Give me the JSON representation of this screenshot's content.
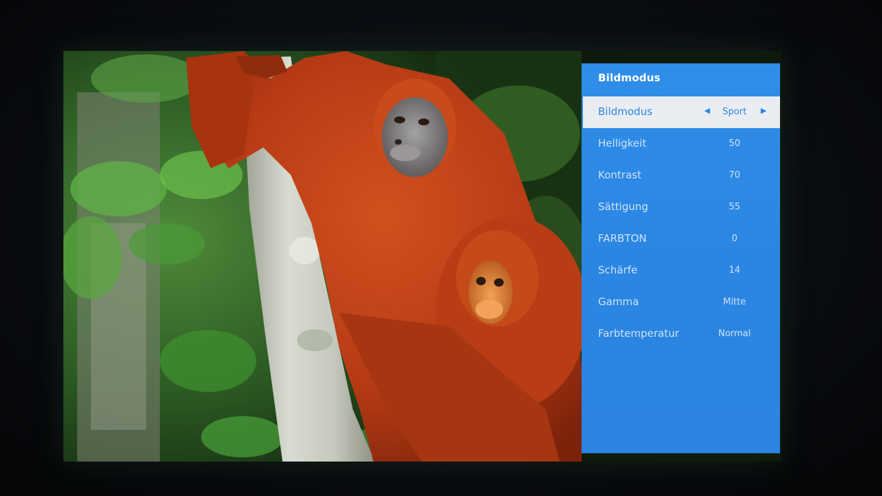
{
  "menu": {
    "title": "Bildmodus",
    "items": [
      {
        "label": "Bildmodus",
        "value": "Sport",
        "selected": true
      },
      {
        "label": "Helligkeit",
        "value": "50"
      },
      {
        "label": "Kontrast",
        "value": "70"
      },
      {
        "label": "Sättigung",
        "value": "55"
      },
      {
        "label": "FARBTON",
        "value": "0"
      },
      {
        "label": "Schärfe",
        "value": "14"
      },
      {
        "label": "Gamma",
        "value": "Mitte"
      },
      {
        "label": "Farbtemperatur",
        "value": "Normal"
      }
    ],
    "left_arrow_icon": "triangle-left-icon",
    "right_arrow_icon": "triangle-right-icon"
  },
  "colors": {
    "menu_background": "#2a86e2",
    "selected_row": "#e9edf2",
    "screen_surround": "#07090c"
  }
}
